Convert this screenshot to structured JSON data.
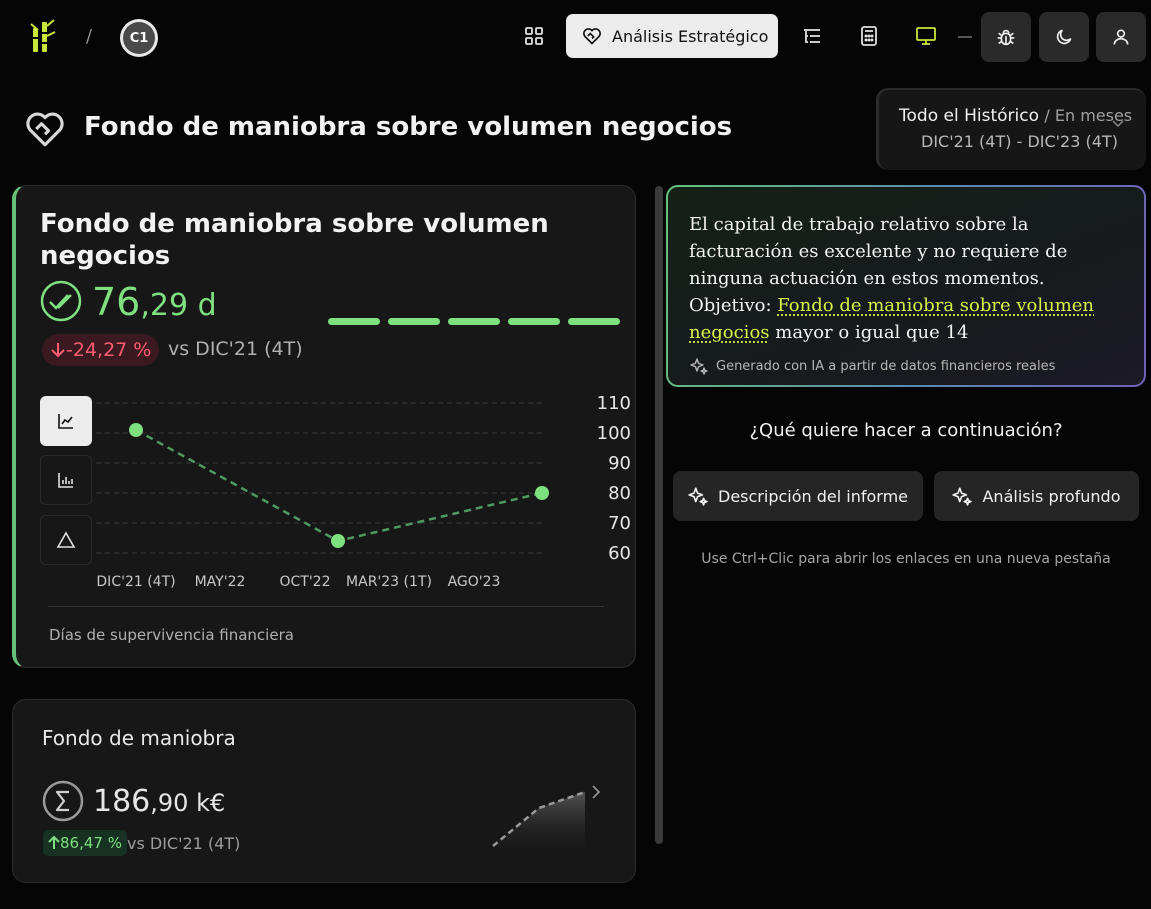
{
  "topbar": {
    "separator": "/",
    "company_initials": "C1",
    "active_label": "Análisis Estratégico"
  },
  "page": {
    "title": "Fondo de maniobra sobre volumen negocios"
  },
  "period": {
    "range_label": "Todo el Histórico",
    "unit_label": "/ En meses",
    "dates": "DIC'21 (4T) - DIC'23 (4T)"
  },
  "main_card": {
    "title": "Fondo de maniobra sobre volumen negocios",
    "value_int": "76",
    "value_dec": ",29 d",
    "delta": "-24,27 %",
    "delta_vs": "vs DIC'21 (4T)",
    "footer": "Días de supervivencia financiera",
    "segments_filled": 5,
    "segments_total": 5
  },
  "chart_data": {
    "type": "line",
    "x": [
      "DIC'21 (4T)",
      "OCT'22",
      "AGO'23"
    ],
    "x_tick_labels": [
      "DIC'21 (4T)",
      "MAY'22",
      "OCT'22",
      "MAR'23 (1T)",
      "AGO'23"
    ],
    "series": [
      {
        "values": [
          101,
          64,
          80
        ]
      }
    ],
    "y_ticks": [
      110,
      100,
      90,
      80,
      70,
      60
    ],
    "ylim": [
      60,
      110
    ],
    "grid": true,
    "colors": {
      "line": "#4f9a62",
      "point": "#7ee07f",
      "grid": "#3a3a3a"
    }
  },
  "card2": {
    "title": "Fondo de maniobra",
    "value_int": "186",
    "value_dec": ",90 k€",
    "delta": "86,47 %",
    "delta_vs": "vs DIC'21 (4T)"
  },
  "insight": {
    "text_before": "El capital de trabajo relativo sobre la facturación es excelente y no requiere de ninguna actuación en estos momentos. Objetivo: ",
    "link": "Fondo de maniobra sobre volumen negocios",
    "text_after": "  mayor o igual que 14",
    "footer": "Generado con IA a partir de datos financieros reales"
  },
  "next": {
    "question": "¿Qué quiere hacer a continuación?",
    "button_description": "Descripción del informe",
    "button_deep": "Análisis profundo",
    "hint": "Use Ctrl+Clic para abrir los enlaces en una nueva pestaña"
  },
  "colors": {
    "accent_green": "#7ee07f",
    "negative_red": "#ff5c72",
    "link_yellow": "#d9f24a"
  }
}
